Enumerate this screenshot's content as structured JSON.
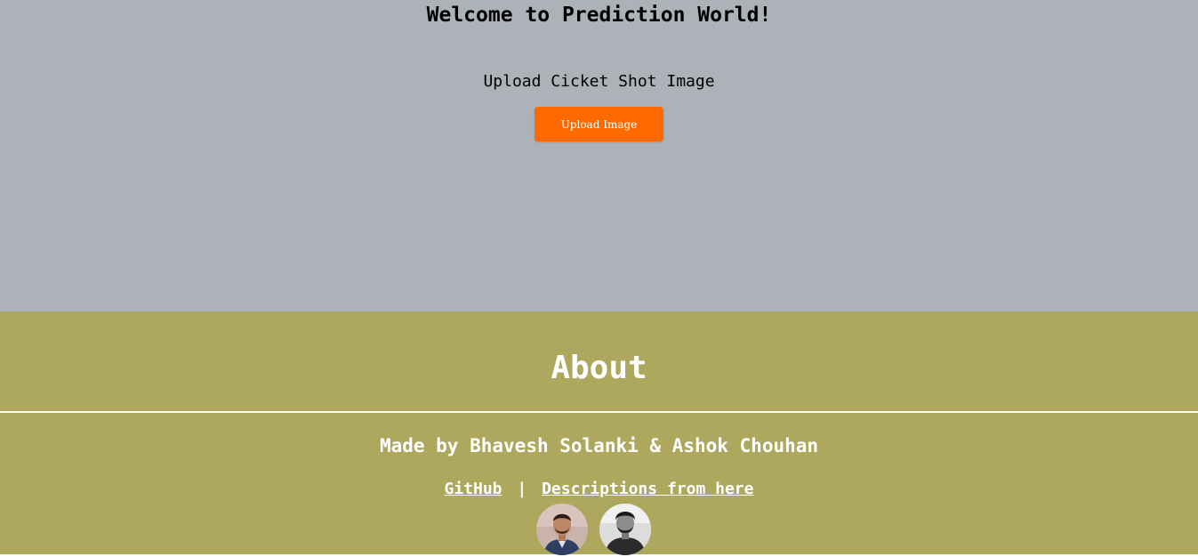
{
  "hero": {
    "title": "Welcome to Prediction World!",
    "upload_label": "Upload Cicket Shot Image",
    "upload_button": "Upload Image"
  },
  "about": {
    "title": "About",
    "credits": "Made by Bhavesh Solanki & Ashok Chouhan",
    "links": [
      {
        "label": "GitHub"
      },
      {
        "label": "Descriptions from here"
      }
    ],
    "separator": "|",
    "avatars": [
      "author-1-avatar",
      "author-2-avatar"
    ]
  },
  "colors": {
    "hero_background": "#adb1b8",
    "about_background": "#aea85e",
    "button_accent": "#ff6a00",
    "about_text": "#ffffff"
  }
}
